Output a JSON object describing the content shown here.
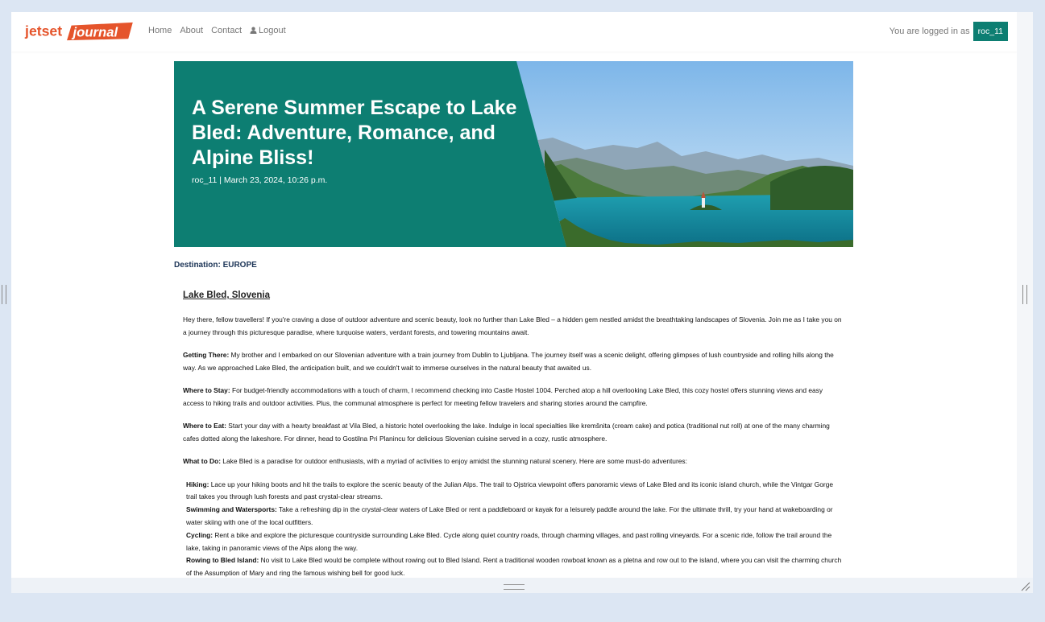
{
  "brand": {
    "name_part1": "jetset",
    "name_part2": "journal"
  },
  "nav": {
    "home": "Home",
    "about": "About",
    "contact": "Contact",
    "logout": "Logout",
    "logged_in_text": "You are logged in as",
    "username": "roc_11"
  },
  "hero": {
    "title": "A Serene Summer Escape to Lake Bled: Adventure, Romance, and Alpine Bliss!",
    "meta": "roc_11 | March 23, 2024, 10:26 p.m."
  },
  "destination": {
    "label": "Destination:",
    "value": "EUROPE"
  },
  "article": {
    "heading": "Lake Bled, Slovenia",
    "intro": "Hey there, fellow travellers! If you're craving a dose of outdoor adventure and scenic beauty, look no further than Lake Bled – a hidden gem nestled amidst the breathtaking landscapes of Slovenia. Join me as I take you on a journey through this picturesque paradise, where turquoise waters, verdant forests, and towering mountains await.",
    "sections": [
      {
        "title": "Getting There:",
        "text": " My brother and I embarked on our Slovenian adventure with a train journey from Dublin to Ljubljana. The journey itself was a scenic delight, offering glimpses of lush countryside and rolling hills along the way. As we approached Lake Bled, the anticipation built, and we couldn't wait to immerse ourselves in the natural beauty that awaited us."
      },
      {
        "title": "Where to Stay:",
        "text": " For budget-friendly accommodations with a touch of charm, I recommend checking into Castle Hostel 1004. Perched atop a hill overlooking Lake Bled, this cozy hostel offers stunning views and easy access to hiking trails and outdoor activities. Plus, the communal atmosphere is perfect for meeting fellow travelers and sharing stories around the campfire."
      },
      {
        "title": "Where to Eat:",
        "text": " Start your day with a hearty breakfast at Vila Bled, a historic hotel overlooking the lake. Indulge in local specialties like kremšnita (cream cake) and potica (traditional nut roll) at one of the many charming cafes dotted along the lakeshore. For dinner, head to Gostilna Pri Planincu for delicious Slovenian cuisine served in a cozy, rustic atmosphere."
      },
      {
        "title": "What to Do:",
        "text": " Lake Bled is a paradise for outdoor enthusiasts, with a myriad of activities to enjoy amidst the stunning natural scenery. Here are some must-do adventures:"
      }
    ],
    "activities": [
      {
        "title": "Hiking:",
        "text": " Lace up your hiking boots and hit the trails to explore the scenic beauty of the Julian Alps. The trail to Ojstrica viewpoint offers panoramic views of Lake Bled and its iconic island church, while the Vintgar Gorge trail takes you through lush forests and past crystal-clear streams."
      },
      {
        "title": "Swimming and Watersports:",
        "text": " Take a refreshing dip in the crystal-clear waters of Lake Bled or rent a paddleboard or kayak for a leisurely paddle around the lake. For the ultimate thrill, try your hand at wakeboarding or water skiing with one of the local outfitters."
      },
      {
        "title": "Cycling:",
        "text": " Rent a bike and explore the picturesque countryside surrounding Lake Bled. Cycle along quiet country roads, through charming villages, and past rolling vineyards. For a scenic ride, follow the trail around the lake, taking in panoramic views of the Alps along the way."
      },
      {
        "title": "Rowing to Bled Island:",
        "text": " No visit to Lake Bled would be complete without rowing out to Bled Island. Rent a traditional wooden rowboat known as a pletna and row out to the island, where you can visit the charming church of the Assumption of Mary and ring the famous wishing bell for good luck."
      }
    ]
  },
  "colors": {
    "accent": "#0d7e72",
    "brand": "#e5542b",
    "background": "#dce6f3"
  }
}
